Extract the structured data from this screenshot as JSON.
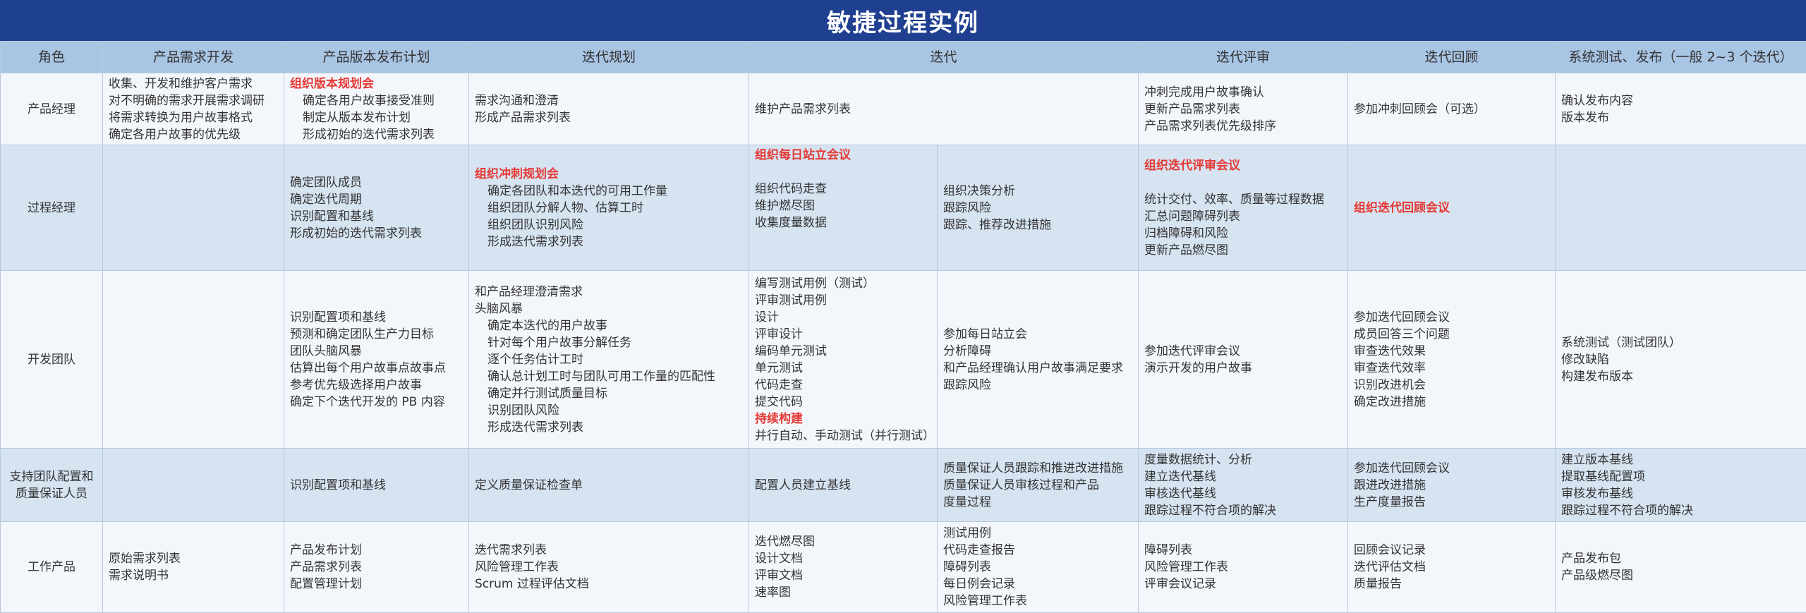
{
  "title": "敏捷过程实例",
  "headers": [
    "角色",
    "产品需求开发",
    "产品版本发布计划",
    "迭代规划",
    "迭代",
    "迭代评审",
    "迭代回顾",
    "系统测试、发布（一般 2~3 个迭代）"
  ],
  "rows": [
    {
      "role": "产品经理",
      "c1": [
        "收集、开发和维护客户需求",
        "对不明确的需求开展需求调研",
        "将需求转换为用户故事格式",
        "确定各用户故事的优先级"
      ],
      "c2_head": "组织版本规划会",
      "c2": [
        "确定各用户故事接受准则",
        "制定从版本发布计划",
        "形成初始的迭代需求列表"
      ],
      "c3": [
        "需求沟通和澄清",
        "形成产品需求列表"
      ],
      "c4": [
        "维护产品需求列表"
      ],
      "c5": [
        "冲刺完成用户故事确认",
        "更新产品需求列表",
        "产品需求列表优先级排序"
      ],
      "c6": [
        "参加冲刺回顾会（可选）"
      ],
      "c7": [
        "确认发布内容",
        "版本发布"
      ]
    },
    {
      "role": "过程经理",
      "c2": [
        "确定团队成员",
        "确定迭代周期",
        "识别配置和基线",
        "形成初始的迭代需求列表"
      ],
      "c3_head": "组织冲刺规划会",
      "c3": [
        "确定各团队和本迭代的可用工作量",
        "组织团队分解人物、估算工时",
        "组织团队识别风险",
        "形成迭代需求列表"
      ],
      "c4a_head": "组织每日站立会议",
      "c4a": [
        "组织代码走查",
        "维护燃尽图",
        "收集度量数据"
      ],
      "c4b": [
        "组织决策分析",
        "跟踪风险",
        "跟踪、推荐改进措施"
      ],
      "c5_head": "组织迭代评审会议",
      "c5": [
        "统计交付、效率、质量等过程数据",
        "汇总问题障碍列表",
        "归档障碍和风险",
        "更新产品燃尽图"
      ],
      "c6_head": "组织迭代回顾会议"
    },
    {
      "role": "开发团队",
      "c2": [
        "识别配置项和基线",
        "预测和确定团队生产力目标",
        "团队头脑风暴",
        "估算出每个用户故事点故事点",
        "参考优先级选择用户故事",
        "确定下个迭代开发的 PB 内容"
      ],
      "c3": [
        "和产品经理澄清需求",
        "头脑风暴"
      ],
      "c3_ind": [
        "确定本迭代的用户故事",
        "针对每个用户故事分解任务",
        "逐个任务估计工时",
        "确认总计划工时与团队可用工作量的匹配性",
        "确定并行测试质量目标",
        "识别团队风险",
        "形成迭代需求列表"
      ],
      "c4a": [
        "编写测试用例（测试）",
        "评审测试用例",
        "设计",
        "评审设计",
        "编码单元测试",
        "单元测试",
        "代码走查",
        "提交代码"
      ],
      "c4a_hl": "持续构建",
      "c4a_tail": "并行自动、手动测试（并行测试）",
      "c4b": [
        "参加每日站立会",
        "分析障碍",
        "和产品经理确认用户故事满足要求",
        "跟踪风险"
      ],
      "c5": [
        "参加迭代评审会议",
        "演示开发的用户故事"
      ],
      "c6": [
        "参加迭代回顾会议",
        "成员回答三个问题",
        "审查迭代效果",
        "审查迭代效率",
        "识别改进机会",
        "确定改进措施"
      ],
      "c7": [
        "系统测试（测试团队）",
        "修改缺陷",
        "构建发布版本"
      ]
    },
    {
      "role_l1": "支持团队配置和",
      "role_l2": "质量保证人员",
      "c2": [
        "识别配置项和基线"
      ],
      "c3": [
        "定义质量保证检查单"
      ],
      "c4a": [
        "配置人员建立基线"
      ],
      "c4b": [
        "质量保证人员跟踪和推进改进措施",
        "质量保证人员审核过程和产品",
        "度量过程"
      ],
      "c5": [
        "度量数据统计、分析",
        "建立迭代基线",
        "审核迭代基线",
        "跟踪过程不符合项的解决"
      ],
      "c6": [
        "参加迭代回顾会议",
        "跟进改进措施",
        "生产度量报告"
      ],
      "c7": [
        "建立版本基线",
        "提取基线配置项",
        "审核发布基线",
        "跟踪过程不符合项的解决"
      ]
    },
    {
      "role": "工作产品",
      "c1": [
        "原始需求列表",
        "需求说明书"
      ],
      "c2": [
        "产品发布计划",
        "产品需求列表",
        "配置管理计划"
      ],
      "c3": [
        "迭代需求列表",
        "风险管理工作表",
        "Scrum 过程评估文档"
      ],
      "c4a": [
        "迭代燃尽图",
        "设计文档",
        "评审文档",
        "速率图"
      ],
      "c4b": [
        "测试用例",
        "代码走查报告",
        "障碍列表",
        "每日例会记录",
        "风险管理工作表"
      ],
      "c5": [
        "障碍列表",
        "风险管理工作表",
        "评审会议记录"
      ],
      "c6": [
        "回顾会议记录",
        "迭代评估文档",
        "质量报告"
      ],
      "c7": [
        "产品发布包",
        "产品级燃尽图"
      ]
    }
  ],
  "colors": {
    "title_bg": "#1f3f91",
    "header_bg": "#a9c5e4",
    "row_light": "#f3f7fc",
    "row_dark": "#d6e3f1",
    "highlight": "#e53935"
  }
}
